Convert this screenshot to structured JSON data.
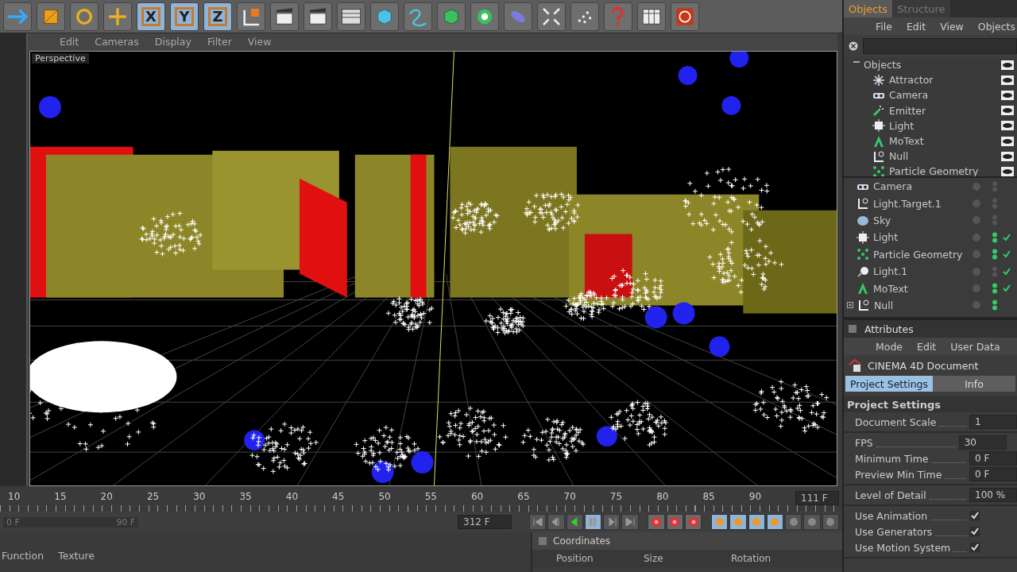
{
  "toolbar": {
    "axes": [
      {
        "label": "X",
        "selected": true
      },
      {
        "label": "Y",
        "selected": true
      },
      {
        "label": "Z",
        "selected": true
      }
    ]
  },
  "viewport": {
    "menu": [
      "Edit",
      "Cameras",
      "Display",
      "Filter",
      "View"
    ],
    "label": "Perspective"
  },
  "timeline": {
    "ticks": [
      "10",
      "15",
      "20",
      "25",
      "30",
      "35",
      "40",
      "45",
      "50",
      "55",
      "60",
      "65",
      "70",
      "75",
      "80",
      "85",
      "90"
    ],
    "end_frame": "111 F",
    "range": {
      "start": "0 F",
      "end": "90 F",
      "level": 1
    },
    "current_frame": "312 F"
  },
  "materials": {
    "menu": [
      "Function",
      "Texture"
    ]
  },
  "coordinates": {
    "title": "Coordinates",
    "columns": [
      "Position",
      "Size",
      "Rotation"
    ]
  },
  "objects_panel": {
    "tabs": [
      {
        "label": "Objects",
        "selected": true
      },
      {
        "label": "Structure",
        "selected": false
      }
    ],
    "menu": [
      "File",
      "Edit",
      "View",
      "Objects"
    ],
    "tree": {
      "label": "Objects",
      "expanded": true,
      "children": [
        {
          "label": "Attractor",
          "kind": "attractor"
        },
        {
          "label": "Camera",
          "kind": "camera"
        },
        {
          "label": "Emitter",
          "kind": "emitter"
        },
        {
          "label": "Light",
          "kind": "light"
        },
        {
          "label": "MoText",
          "kind": "text"
        },
        {
          "label": "Null",
          "kind": "null"
        },
        {
          "label": "Particle Geometry",
          "kind": "particles"
        }
      ]
    },
    "scene": [
      {
        "label": "Camera",
        "kind": "camera",
        "active": false,
        "checked": false,
        "expandable": false
      },
      {
        "label": "Light.Target.1",
        "kind": "null",
        "active": false,
        "checked": false,
        "expandable": false
      },
      {
        "label": "Sky",
        "kind": "sky",
        "active": false,
        "checked": false,
        "expandable": false
      },
      {
        "label": "Light",
        "kind": "light",
        "active": true,
        "checked": true,
        "expandable": false
      },
      {
        "label": "Particle Geometry",
        "kind": "particles",
        "active": true,
        "checked": true,
        "expandable": false
      },
      {
        "label": "Light.1",
        "kind": "spot",
        "active": false,
        "checked": true,
        "expandable": false
      },
      {
        "label": "MoText",
        "kind": "text",
        "active": true,
        "checked": true,
        "expandable": false
      },
      {
        "label": "Null",
        "kind": "null",
        "active": true,
        "checked": false,
        "expandable": true
      }
    ]
  },
  "attributes": {
    "title": "Attributes",
    "menu": [
      "Mode",
      "Edit",
      "User Data"
    ],
    "object": "CINEMA 4D Document",
    "tabs": [
      {
        "label": "Project Settings",
        "selected": true
      },
      {
        "label": "Info",
        "selected": false
      }
    ],
    "section": "Project Settings",
    "groups": [
      [
        {
          "kind": "value",
          "label": "Document Scale",
          "value": "1"
        }
      ],
      [
        {
          "kind": "value",
          "label": "FPS",
          "value": "30"
        },
        {
          "kind": "value",
          "label": "Minimum Time",
          "value": "0 F"
        },
        {
          "kind": "value",
          "label": "Preview Min Time",
          "value": "0 F"
        }
      ],
      [
        {
          "kind": "value",
          "label": "Level of Detail",
          "value": "100 %"
        }
      ],
      [
        {
          "kind": "check",
          "label": "Use Animation",
          "checked": true
        },
        {
          "kind": "check",
          "label": "Use Generators",
          "checked": true
        },
        {
          "kind": "check",
          "label": "Use Motion System",
          "checked": true
        }
      ]
    ]
  }
}
